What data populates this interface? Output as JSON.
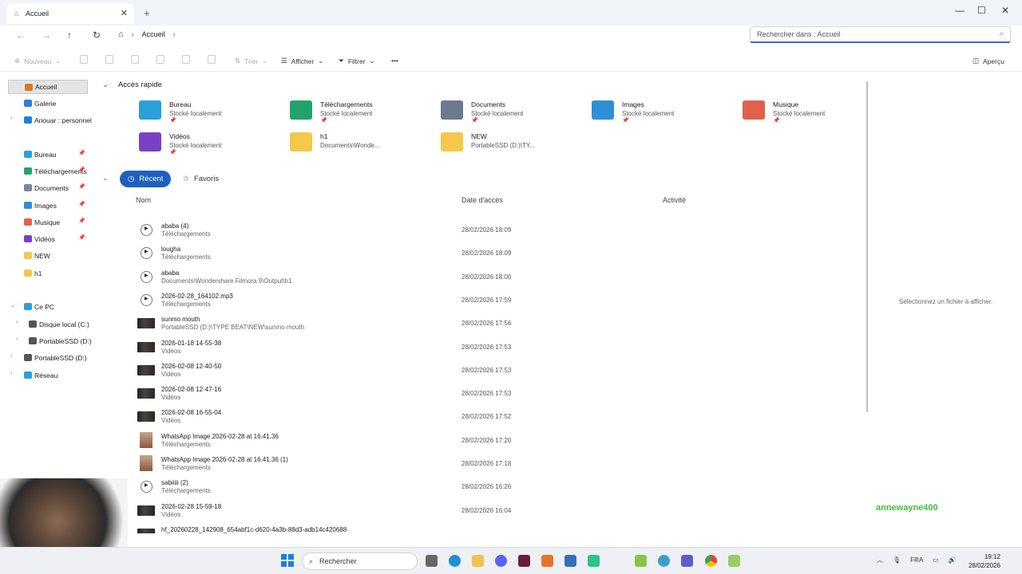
{
  "window": {
    "tab_title": "Accueil",
    "new_tab": "+",
    "close_tab": "✕",
    "minimize": "—",
    "maximize": "☐",
    "close": "✕"
  },
  "address": {
    "breadcrumb": [
      "Accueil"
    ],
    "search_placeholder": "Rechercher dans : Accueil"
  },
  "toolbar": {
    "new_label": "Nouveau",
    "sort_label": "Trier",
    "view_label": "Afficher",
    "filter_label": "Filtrer",
    "more_label": "•••",
    "preview_label": "Aperçu"
  },
  "sidebar": {
    "items": [
      {
        "label": "Accueil",
        "icon": "home-icon",
        "selected": true
      },
      {
        "label": "Galerie",
        "icon": "gallery-icon"
      },
      {
        "label": "Anouar : personnel",
        "icon": "cloud-icon"
      },
      {
        "label": "Bureau",
        "icon": "desktop-icon",
        "pinned": true
      },
      {
        "label": "Téléchargements",
        "icon": "download-icon",
        "pinned": true
      },
      {
        "label": "Documents",
        "icon": "documents-icon",
        "pinned": true
      },
      {
        "label": "Images",
        "icon": "images-icon",
        "pinned": true
      },
      {
        "label": "Musique",
        "icon": "music-icon",
        "pinned": true
      },
      {
        "label": "Vidéos",
        "icon": "videos-icon",
        "pinned": true
      },
      {
        "label": "NEW",
        "icon": "folder-icon"
      },
      {
        "label": "h1",
        "icon": "folder-icon"
      },
      {
        "label": "Ce PC",
        "icon": "pc-icon"
      },
      {
        "label": "Disque local (C:)",
        "icon": "drive-icon"
      },
      {
        "label": "PortableSSD (D:)",
        "icon": "drive-icon"
      },
      {
        "label": "PortableSSD (D:)",
        "icon": "drive-icon"
      },
      {
        "label": "Réseau",
        "icon": "network-icon"
      }
    ]
  },
  "quick_access": {
    "title": "Accès rapide",
    "items": [
      {
        "name": "Bureau",
        "sub": "Stocké localement",
        "pinned": true,
        "color": "#2b9fd9"
      },
      {
        "name": "Téléchargements",
        "sub": "Stocké localement",
        "pinned": true,
        "color": "#23a36b"
      },
      {
        "name": "Documents",
        "sub": "Stocké localement",
        "pinned": true,
        "color": "#6b7a8f"
      },
      {
        "name": "Images",
        "sub": "Stocké localement",
        "pinned": true,
        "color": "#2e8fd6"
      },
      {
        "name": "Musique",
        "sub": "Stocké localement",
        "pinned": true,
        "color": "#e0624c"
      },
      {
        "name": "Vidéos",
        "sub": "Stocké localement",
        "pinned": true,
        "color": "#7b3fc6"
      },
      {
        "name": "h1",
        "sub": "Documents\\Wonde...",
        "pinned": false,
        "color": "#f3c84b"
      },
      {
        "name": "NEW",
        "sub": "PortableSSD (D:)\\TY...",
        "pinned": false,
        "color": "#f3c84b"
      }
    ]
  },
  "tabs": {
    "recent": "Récent",
    "favorites": "Favoris"
  },
  "columns": {
    "name": "Nom",
    "date": "Date d'accès",
    "activity": "Activité"
  },
  "files": [
    {
      "name": "ababa (4)",
      "location": "Téléchargements",
      "date": "28/02/2026 18:09",
      "kind": "audio"
    },
    {
      "name": "lougha",
      "location": "Téléchargements",
      "date": "28/02/2026 18:09",
      "kind": "audio"
    },
    {
      "name": "ababa",
      "location": "Documents\\Wondershare Filmora 9\\Output\\h1",
      "date": "28/02/2026 18:00",
      "kind": "audio"
    },
    {
      "name": "2026-02-28_164102.mp3",
      "location": "Téléchargements",
      "date": "28/02/2026 17:59",
      "kind": "audio"
    },
    {
      "name": "sunmo mouth",
      "location": "PortableSSD (D:)\\TYPE BEAT\\NEW\\sunmo mouth",
      "date": "28/02/2026 17:56",
      "kind": "video"
    },
    {
      "name": "2026-01-18 14-55-38",
      "location": "Vidéos",
      "date": "28/02/2026 17:53",
      "kind": "video"
    },
    {
      "name": "2026-02-08 12-40-50",
      "location": "Vidéos",
      "date": "28/02/2026 17:53",
      "kind": "video"
    },
    {
      "name": "2026-02-08 12-47-16",
      "location": "Vidéos",
      "date": "28/02/2026 17:53",
      "kind": "video"
    },
    {
      "name": "2026-02-08 16-55-04",
      "location": "Vidéos",
      "date": "28/02/2026 17:52",
      "kind": "video"
    },
    {
      "name": "WhatsApp Image 2026-02-28 at 16.41.36",
      "location": "Téléchargements",
      "date": "28/02/2026 17:20",
      "kind": "image"
    },
    {
      "name": "WhatsApp Image 2026-02-28 at 16.41.36 (1)",
      "location": "Téléchargements",
      "date": "28/02/2026 17:18",
      "kind": "image"
    },
    {
      "name": "sabiiiii (2)",
      "location": "Téléchargements",
      "date": "28/02/2026 16:26",
      "kind": "audio"
    },
    {
      "name": "2026-02-28 15-59-18",
      "location": "Vidéos",
      "date": "28/02/2026 16:04",
      "kind": "video"
    },
    {
      "name": "hf_20260228_142908_654abf1c-d620-4a3b-88d3-adb14c420688",
      "location": "",
      "date": "",
      "kind": "video"
    }
  ],
  "preview_pane": {
    "message": "Sélectionnez un fichier à afficher."
  },
  "overlay": {
    "username": "annewayne400"
  },
  "taskbar": {
    "search_placeholder": "Rechercher",
    "language": "FRA",
    "time": "19:12",
    "date": "28/02/2026"
  }
}
